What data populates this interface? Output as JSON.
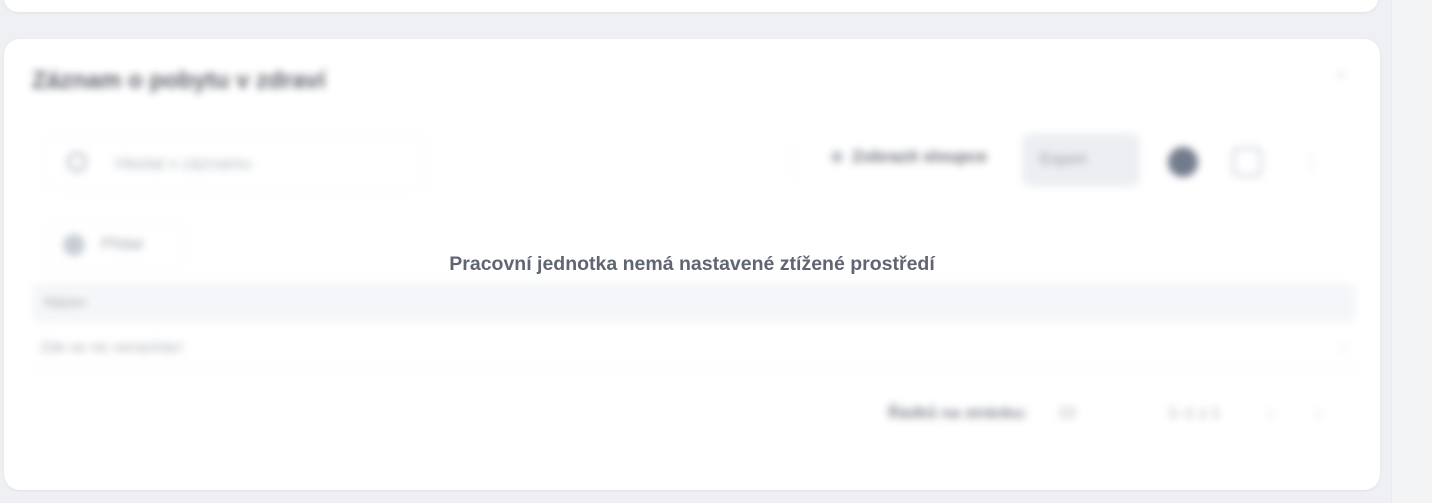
{
  "overlay": {
    "message": "Pracovní jednotka nemá nastavené ztížené prostředí"
  },
  "card": {
    "title": "Záznam o pobytu v zdraví",
    "search_placeholder": "Hledat v záznamu",
    "filter_label": "Zobrazit sloupce",
    "export_label": "Export",
    "add_label": "Přidat",
    "table_header": "Název",
    "table_row": "Zde se nic nenachází",
    "pager": {
      "rows_label": "Řádků na stránku:",
      "rows_value": "10",
      "range": "1–1 z 1"
    }
  },
  "icons": {
    "collapse": "chevron-up-icon",
    "search": "search-icon",
    "filter": "columns-icon",
    "avatar": "user-circle-icon",
    "print": "printer-icon",
    "more": "more-vertical-icon",
    "add": "plus-icon",
    "row_chevron": "chevron-right-icon"
  },
  "colors": {
    "message_text": "#5f6672",
    "card_bg": "#ffffff",
    "page_bg": "#eef0f3"
  }
}
